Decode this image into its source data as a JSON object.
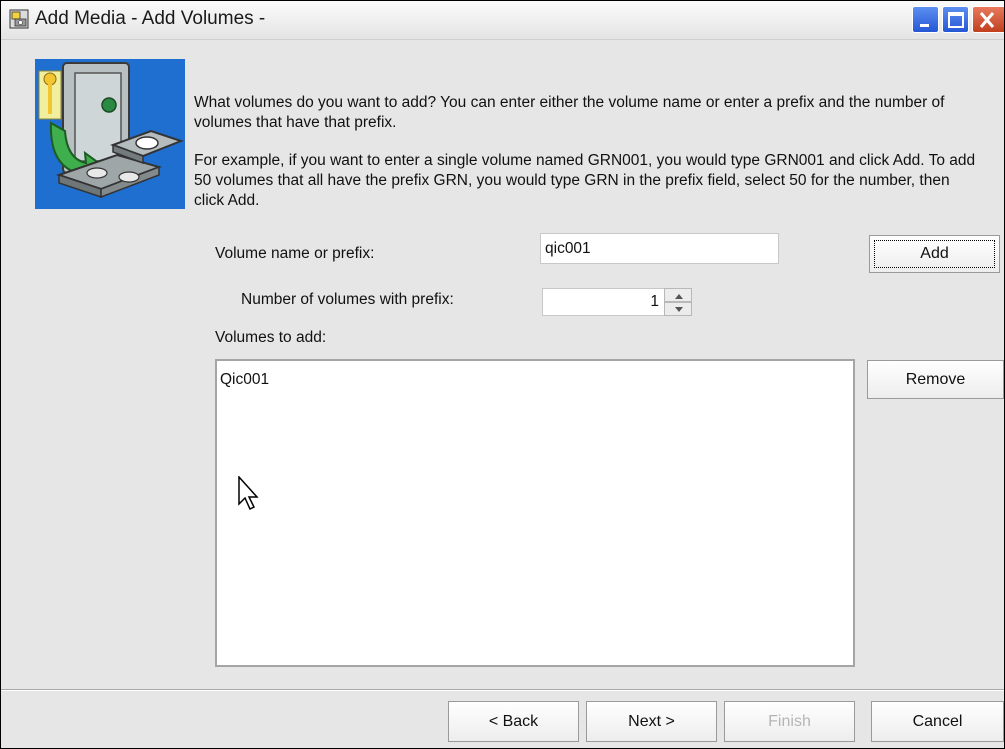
{
  "window": {
    "title": "Add Media - Add Volumes -",
    "controls": {
      "minimize_icon": "minimize-icon",
      "maximize_icon": "maximize-icon",
      "close_icon": "close-icon"
    }
  },
  "illustration_icon": "media-safe-icon",
  "instructions": {
    "paragraph1": "What volumes do you want to add? You can enter either the volume name or enter a prefix and the number of volumes that have that prefix.",
    "paragraph2": "For example, if you want to enter a single volume named GRN001, you would type GRN001 and click Add. To add 50 volumes that all have the prefix GRN, you would type GRN in the prefix field, select 50 for the number, then click Add."
  },
  "form": {
    "volume_name_label": "Volume name or prefix:",
    "volume_name_value": "qic001",
    "add_label": "Add",
    "number_label": "Number of volumes with prefix:",
    "number_value": "1",
    "volumes_label": "Volumes to add:",
    "volumes": [
      "Qic001"
    ],
    "remove_label": "Remove"
  },
  "footer": {
    "back_label": "< Back",
    "next_label": "Next >",
    "finish_label": "Finish",
    "cancel_label": "Cancel"
  },
  "colors": {
    "titlebar_button_blue": "#2557d6",
    "close_button_red": "#c0401f",
    "dialog_background": "#e6e6e6",
    "disabled_text": "#b5b5b5"
  }
}
